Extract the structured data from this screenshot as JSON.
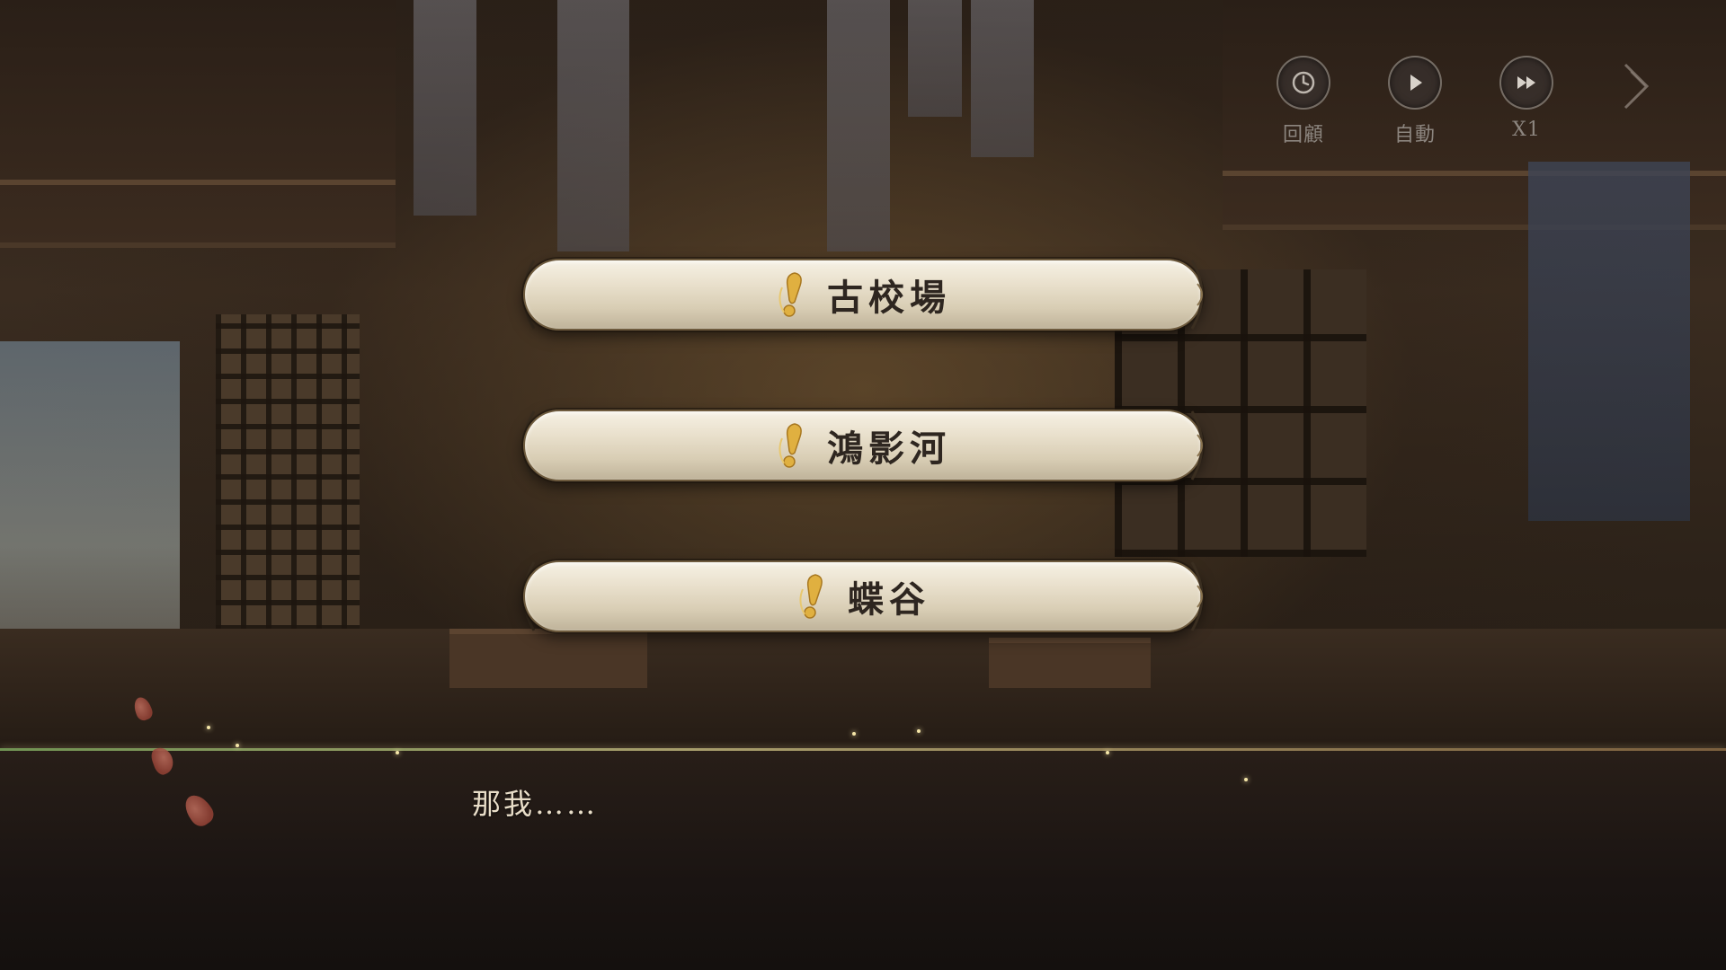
{
  "controls": [
    {
      "id": "history",
      "label": "回顧",
      "icon": "clock-icon"
    },
    {
      "id": "auto",
      "label": "自動",
      "icon": "play-icon"
    },
    {
      "id": "speed",
      "label": "X1",
      "icon": "fast-forward-icon"
    }
  ],
  "next_icon": "chevron-right-icon",
  "choices": [
    {
      "label": "古校場",
      "icon": "exclamation-icon"
    },
    {
      "label": "鴻影河",
      "icon": "exclamation-icon"
    },
    {
      "label": "蝶谷",
      "icon": "exclamation-icon"
    }
  ],
  "dialog": {
    "text": "那我……"
  },
  "colors": {
    "choice_bg": "#efe7d4",
    "choice_text": "#2e2620",
    "accent_gold": "#e0b040",
    "dialog_text": "#e8ddc8",
    "control_label": "#aaa5a0"
  }
}
